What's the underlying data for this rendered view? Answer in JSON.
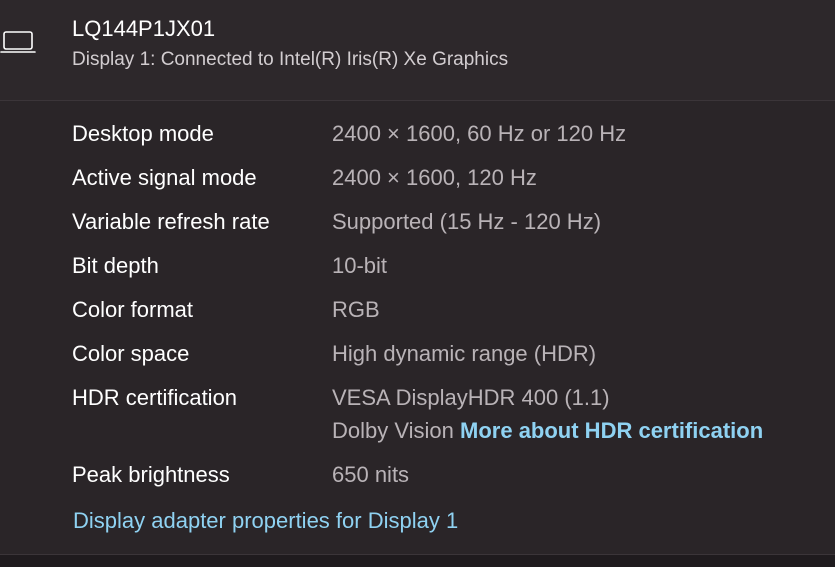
{
  "header": {
    "device_name": "LQ144P1JX01",
    "device_subtitle": "Display 1: Connected to Intel(R) Iris(R) Xe Graphics",
    "icon": "laptop-icon"
  },
  "rows": [
    {
      "label": "Desktop mode",
      "value": "2400 × 1600, 60 Hz or 120 Hz"
    },
    {
      "label": "Active signal mode",
      "value": "2400 × 1600, 120 Hz"
    },
    {
      "label": "Variable refresh rate",
      "value": "Supported (15 Hz - 120 Hz)"
    },
    {
      "label": "Bit depth",
      "value": "10-bit"
    },
    {
      "label": "Color format",
      "value": "RGB"
    },
    {
      "label": "Color space",
      "value": "High dynamic range (HDR)"
    },
    {
      "label": "HDR certification",
      "value": "VESA DisplayHDR 400 (1.1)",
      "value_line2": "Dolby Vision",
      "link": "More about HDR certification"
    },
    {
      "label": "Peak brightness",
      "value": "650 nits"
    }
  ],
  "adapter_link": "Display adapter properties for Display 1",
  "colors": {
    "background": "#2a2528",
    "header_background": "#2d282b",
    "label_text": "#ffffff",
    "value_text": "#b9b3b7",
    "link": "#8fd2f2"
  }
}
